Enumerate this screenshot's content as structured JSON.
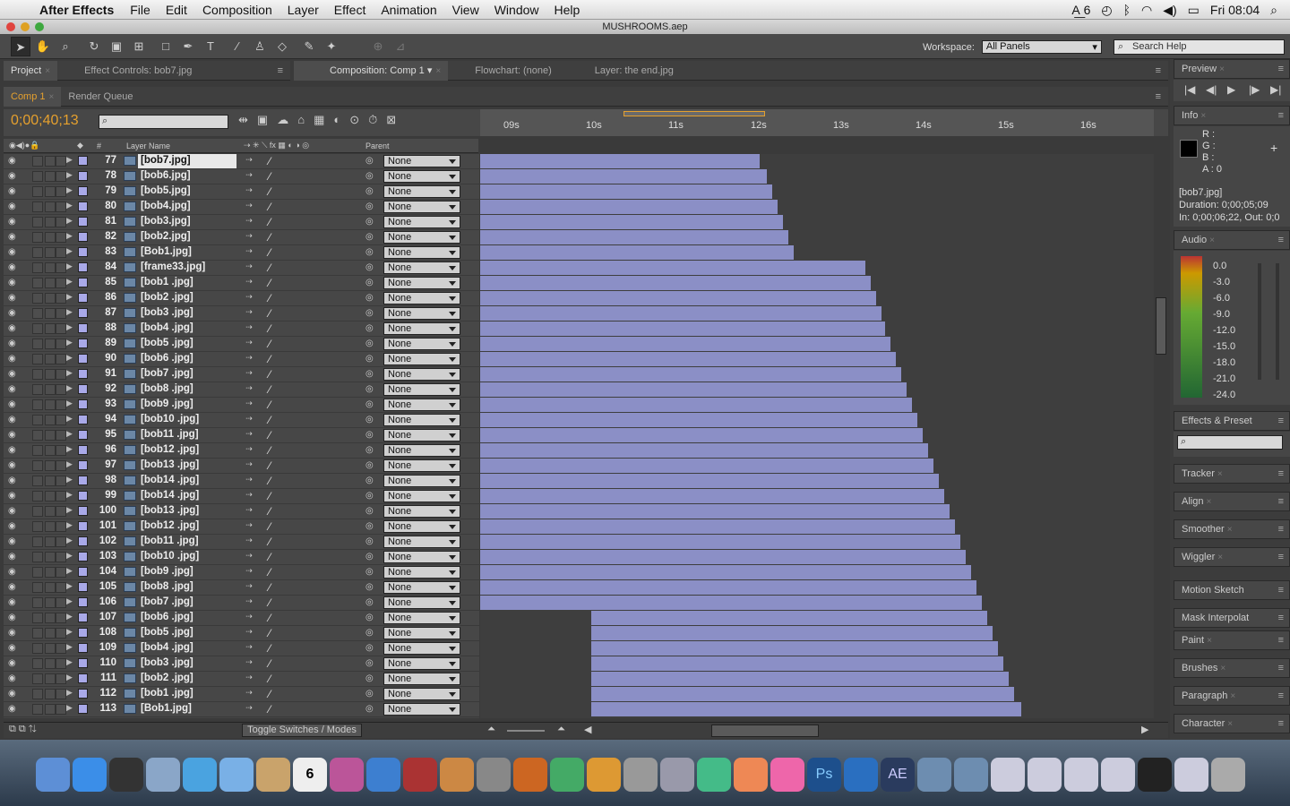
{
  "menubar": {
    "app": "After Effects",
    "items": [
      "File",
      "Edit",
      "Composition",
      "Layer",
      "Effect",
      "Animation",
      "View",
      "Window",
      "Help"
    ],
    "right": {
      "adobe_badge": "6",
      "clock": "Fri 08:04"
    }
  },
  "window_title": "MUSHROOMS.aep",
  "workspace": {
    "label": "Workspace:",
    "value": "All Panels"
  },
  "search_help": {
    "placeholder": "Search Help"
  },
  "panels_top": {
    "project": "Project",
    "effect_controls": "Effect Controls: bob7.jpg",
    "composition": "Composition: Comp 1",
    "flowchart": "Flowchart: (none)",
    "layer": "Layer: the end.jpg"
  },
  "timeline_tabs": {
    "comp": "Comp 1",
    "render": "Render Queue"
  },
  "timecode": "0;00;40;13",
  "ruler_ticks": [
    "09s",
    "10s",
    "11s",
    "12s",
    "13s",
    "14s",
    "15s",
    "16s"
  ],
  "columns": {
    "layer_name": "Layer Name",
    "num": "#",
    "parent": "Parent"
  },
  "footer": {
    "toggle": "Toggle Switches / Modes"
  },
  "layers": [
    {
      "num": "77",
      "name": "[bob7.jpg]",
      "start": 0,
      "end": 312
    },
    {
      "num": "78",
      "name": "[bob6.jpg]",
      "start": 0,
      "end": 320
    },
    {
      "num": "79",
      "name": "[bob5.jpg]",
      "start": 0,
      "end": 326
    },
    {
      "num": "80",
      "name": "[bob4.jpg]",
      "start": 0,
      "end": 332
    },
    {
      "num": "81",
      "name": "[bob3.jpg]",
      "start": 0,
      "end": 338
    },
    {
      "num": "82",
      "name": "[bob2.jpg]",
      "start": 0,
      "end": 344
    },
    {
      "num": "83",
      "name": "[Bob1.jpg]",
      "start": 0,
      "end": 350
    },
    {
      "num": "84",
      "name": "[frame33.jpg]",
      "start": 0,
      "end": 430
    },
    {
      "num": "85",
      "name": "[bob1 .jpg]",
      "start": 0,
      "end": 436
    },
    {
      "num": "86",
      "name": "[bob2 .jpg]",
      "start": 0,
      "end": 442
    },
    {
      "num": "87",
      "name": "[bob3 .jpg]",
      "start": 0,
      "end": 448
    },
    {
      "num": "88",
      "name": "[bob4 .jpg]",
      "start": 0,
      "end": 452
    },
    {
      "num": "89",
      "name": "[bob5 .jpg]",
      "start": 0,
      "end": 458
    },
    {
      "num": "90",
      "name": "[bob6 .jpg]",
      "start": 0,
      "end": 464
    },
    {
      "num": "91",
      "name": "[bob7 .jpg]",
      "start": 0,
      "end": 470
    },
    {
      "num": "92",
      "name": "[bob8 .jpg]",
      "start": 0,
      "end": 476
    },
    {
      "num": "93",
      "name": "[bob9 .jpg]",
      "start": 0,
      "end": 482
    },
    {
      "num": "94",
      "name": "[bob10 .jpg]",
      "start": 0,
      "end": 488
    },
    {
      "num": "95",
      "name": "[bob11 .jpg]",
      "start": 0,
      "end": 494
    },
    {
      "num": "96",
      "name": "[bob12 .jpg]",
      "start": 0,
      "end": 500
    },
    {
      "num": "97",
      "name": "[bob13 .jpg]",
      "start": 0,
      "end": 506
    },
    {
      "num": "98",
      "name": "[bob14 .jpg]",
      "start": 0,
      "end": 512
    },
    {
      "num": "99",
      "name": "[bob14 .jpg]",
      "start": 0,
      "end": 518
    },
    {
      "num": "100",
      "name": "[bob13 .jpg]",
      "start": 0,
      "end": 524
    },
    {
      "num": "101",
      "name": "[bob12 .jpg]",
      "start": 0,
      "end": 530
    },
    {
      "num": "102",
      "name": "[bob11 .jpg]",
      "start": 0,
      "end": 536
    },
    {
      "num": "103",
      "name": "[bob10 .jpg]",
      "start": 0,
      "end": 542
    },
    {
      "num": "104",
      "name": "[bob9 .jpg]",
      "start": 0,
      "end": 548
    },
    {
      "num": "105",
      "name": "[bob8 .jpg]",
      "start": 0,
      "end": 554
    },
    {
      "num": "106",
      "name": "[bob7 .jpg]",
      "start": 0,
      "end": 560
    },
    {
      "num": "107",
      "name": "[bob6 .jpg]",
      "start": 124,
      "end": 566
    },
    {
      "num": "108",
      "name": "[bob5 .jpg]",
      "start": 124,
      "end": 572
    },
    {
      "num": "109",
      "name": "[bob4 .jpg]",
      "start": 124,
      "end": 578
    },
    {
      "num": "110",
      "name": "[bob3 .jpg]",
      "start": 124,
      "end": 584
    },
    {
      "num": "111",
      "name": "[bob2 .jpg]",
      "start": 124,
      "end": 590
    },
    {
      "num": "112",
      "name": "[bob1 .jpg]",
      "start": 124,
      "end": 596
    },
    {
      "num": "113",
      "name": "[Bob1.jpg]",
      "start": 124,
      "end": 604
    }
  ],
  "parent_value": "None",
  "right_panels": {
    "preview": "Preview",
    "info": "Info",
    "info_rgb": [
      "R :",
      "G :",
      "B :",
      "A : 0"
    ],
    "info_layer": "[bob7.jpg]",
    "info_duration": "Duration: 0;00;05;09",
    "info_inout": "In: 0;00;06;22, Out: 0;0",
    "audio": "Audio",
    "audio_levels": [
      "0.0",
      "-3.0",
      "-6.0",
      "-9.0",
      "-12.0",
      "-15.0",
      "-18.0",
      "-21.0",
      "-24.0"
    ],
    "effects": "Effects & Preset",
    "tracker": "Tracker",
    "align": "Align",
    "smoother": "Smoother",
    "wiggler": "Wiggler",
    "motion_sketch": "Motion Sketch",
    "mask_interp": "Mask Interpolat",
    "paint": "Paint",
    "brushes": "Brushes",
    "paragraph": "Paragraph",
    "character": "Character"
  },
  "dock_icons": [
    "finder-icon",
    "app-store-icon",
    "dashboard-icon",
    "preview-icon",
    "safari-icon",
    "facetime-icon",
    "address-book-icon",
    "calendar-icon",
    "photos-icon",
    "itunes-icon",
    "photo-booth-icon",
    "iphoto-icon",
    "imovie-icon",
    "garageband-icon",
    "time-machine-icon",
    "keynote-icon",
    "system-prefs-icon",
    "pen-icon",
    "numbers-icon",
    "pages-icon",
    "colors-icon",
    "photoshop-icon",
    "quicktime-icon",
    "after-effects-icon",
    "folder-icon",
    "folder-icon",
    "window-icon",
    "window-icon",
    "window-icon",
    "window-icon",
    "monitor-icon",
    "window-icon",
    "trash-icon"
  ],
  "dock_calendar_day": "6",
  "colors": {
    "timecode": "#e5a02e",
    "bar": "#8b8fc6",
    "label": "#a9a9e8"
  }
}
